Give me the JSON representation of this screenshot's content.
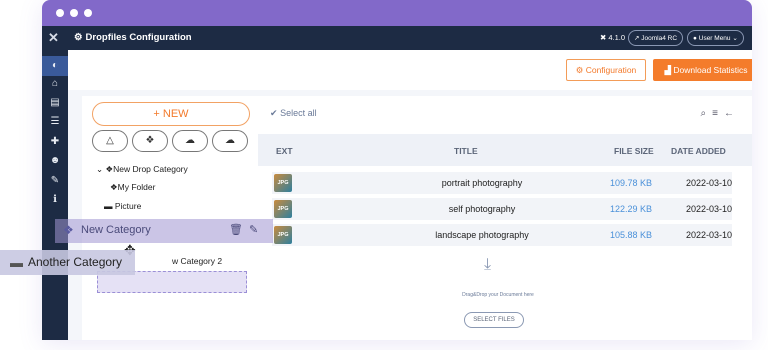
{
  "topbar": {
    "title": "Dropfiles Configuration",
    "version": "4.1.0",
    "joomla_btn": "Joomla4 RC",
    "user_menu": "User Menu"
  },
  "toolbar": {
    "config_label": "Configuration",
    "stats_label": "Download Statistics"
  },
  "left": {
    "new_label": "+ NEW",
    "tree": [
      "New Drop Category",
      "My Folder",
      "Picture",
      "w Category 2"
    ],
    "drag_category": "New Category",
    "another_category": "Another Category"
  },
  "main": {
    "select_all": "Select all",
    "columns": [
      "EXT",
      "TITLE",
      "FILE SIZE",
      "DATE ADDED"
    ],
    "rows": [
      {
        "ext": "JPG",
        "title": "portrait photography",
        "size": "109.78 KB",
        "date": "2022-03-10"
      },
      {
        "ext": "JPG",
        "title": "self photography",
        "size": "122.29 KB",
        "date": "2022-03-10"
      },
      {
        "ext": "JPG",
        "title": "landscape photography",
        "size": "105.88 KB",
        "date": "2022-03-10"
      }
    ],
    "drop_text": "Drag&Drop your Document here",
    "select_files": "SELECT FILES"
  }
}
